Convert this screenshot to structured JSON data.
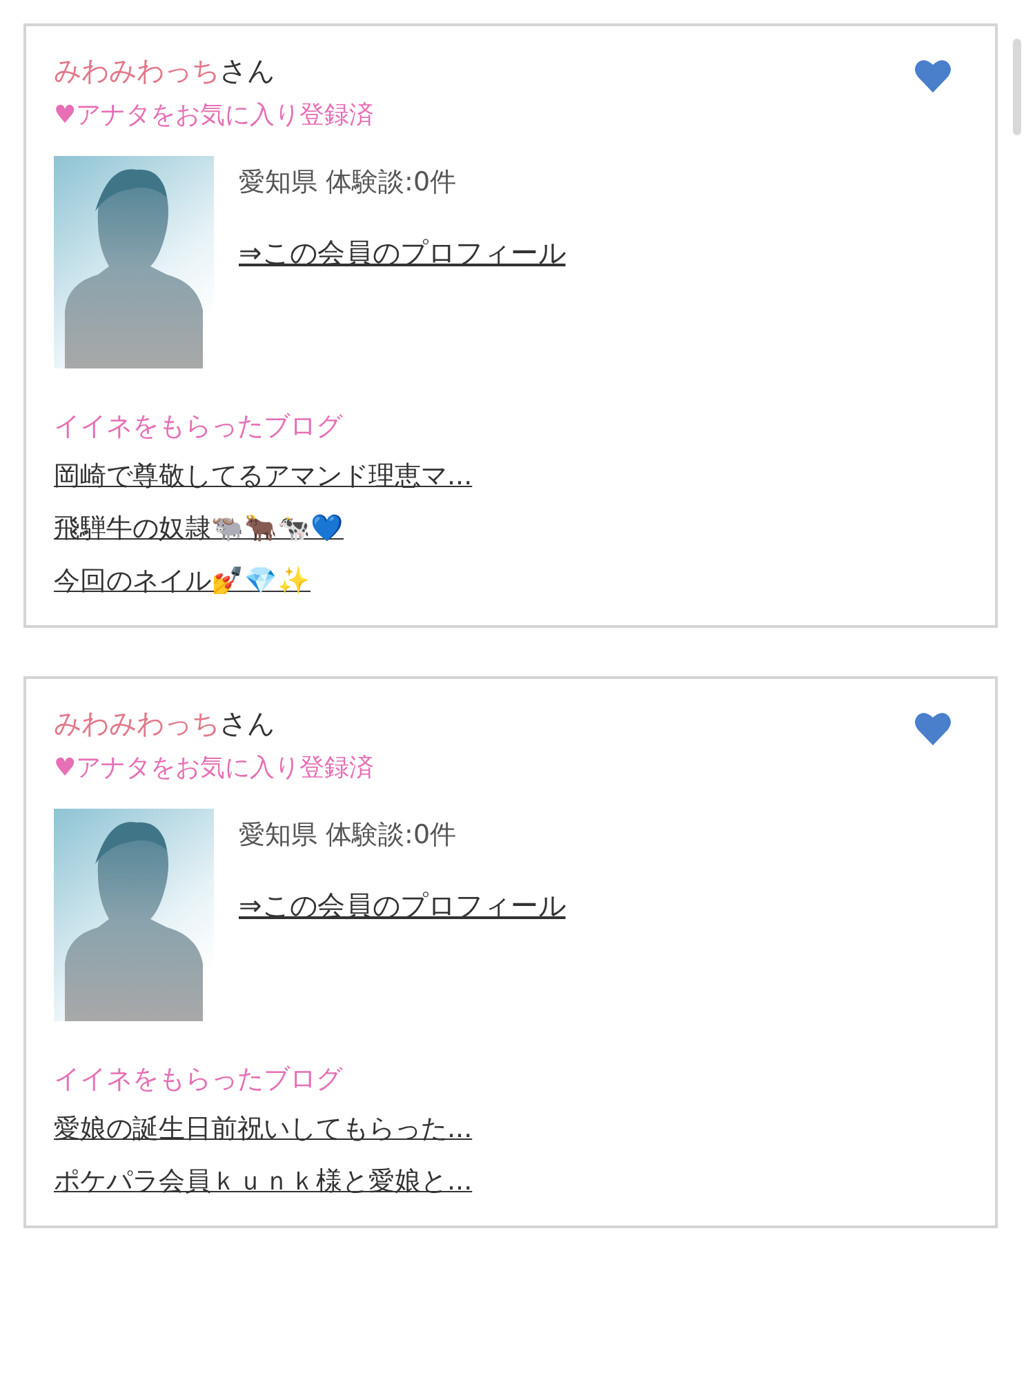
{
  "members": [
    {
      "name": "みわみわっち",
      "honorific": "さん",
      "favorited_by_you": "♥アナタをお気に入り登録済",
      "favorite": true,
      "photo": {
        "kind": "picture"
      },
      "info": "愛知県  体験談:0件",
      "profile_link": "⇒この会員のプロフィール",
      "blog_heading": "イイネをもらったブログ",
      "blogs": [
        "岡崎で尊敬してるアマンド理恵マ...",
        "飛騨牛の奴隷🐃🐂🐄💙",
        "今回のネイル💅💎✨"
      ]
    },
    {
      "name": "みわみわっち",
      "honorific": "さん",
      "favorited_by_you": "♥アナタをお気に入り登録済",
      "favorite": true,
      "photo": {
        "kind": "picture"
      },
      "info": "愛知県  体験談:0件",
      "profile_link": "⇒この会員のプロフィール",
      "blog_heading": "イイネをもらったブログ",
      "blogs": [
        "愛娘の誕生日前祝いしてもらった...",
        "ポケパラ会員ｋｕｎｋ様と愛娘と..."
      ]
    }
  ]
}
